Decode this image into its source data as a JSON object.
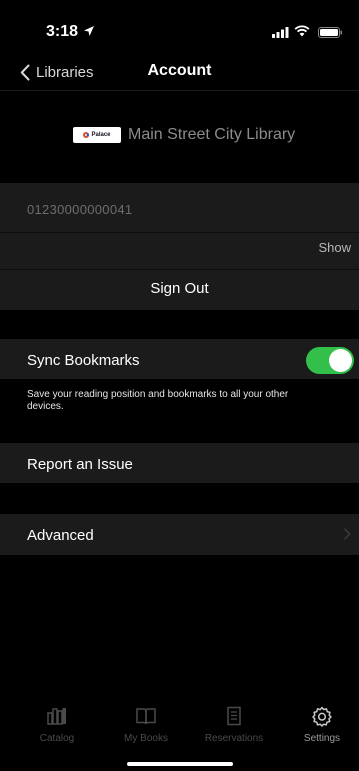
{
  "status_bar": {
    "time": "3:18"
  },
  "nav": {
    "back_label": "Libraries",
    "title": "Account"
  },
  "library": {
    "logo_text": "Palace",
    "name": "Main Street City Library"
  },
  "account_card": {
    "barcode": "01230000000041",
    "show_label": "Show",
    "sign_out_label": "Sign Out"
  },
  "sync": {
    "label": "Sync Bookmarks",
    "enabled": true,
    "description": "Save your reading position and bookmarks to all your other devices."
  },
  "report_issue": {
    "label": "Report an Issue"
  },
  "advanced": {
    "label": "Advanced"
  },
  "tabs": [
    {
      "label": "Catalog",
      "icon": "catalog-icon"
    },
    {
      "label": "My Books",
      "icon": "book-icon"
    },
    {
      "label": "Reservations",
      "icon": "reservations-icon"
    },
    {
      "label": "Settings",
      "icon": "gear-icon"
    }
  ],
  "colors": {
    "toggle_on": "#33c04a",
    "background": "#000000",
    "row_background": "#1b1b1b"
  }
}
